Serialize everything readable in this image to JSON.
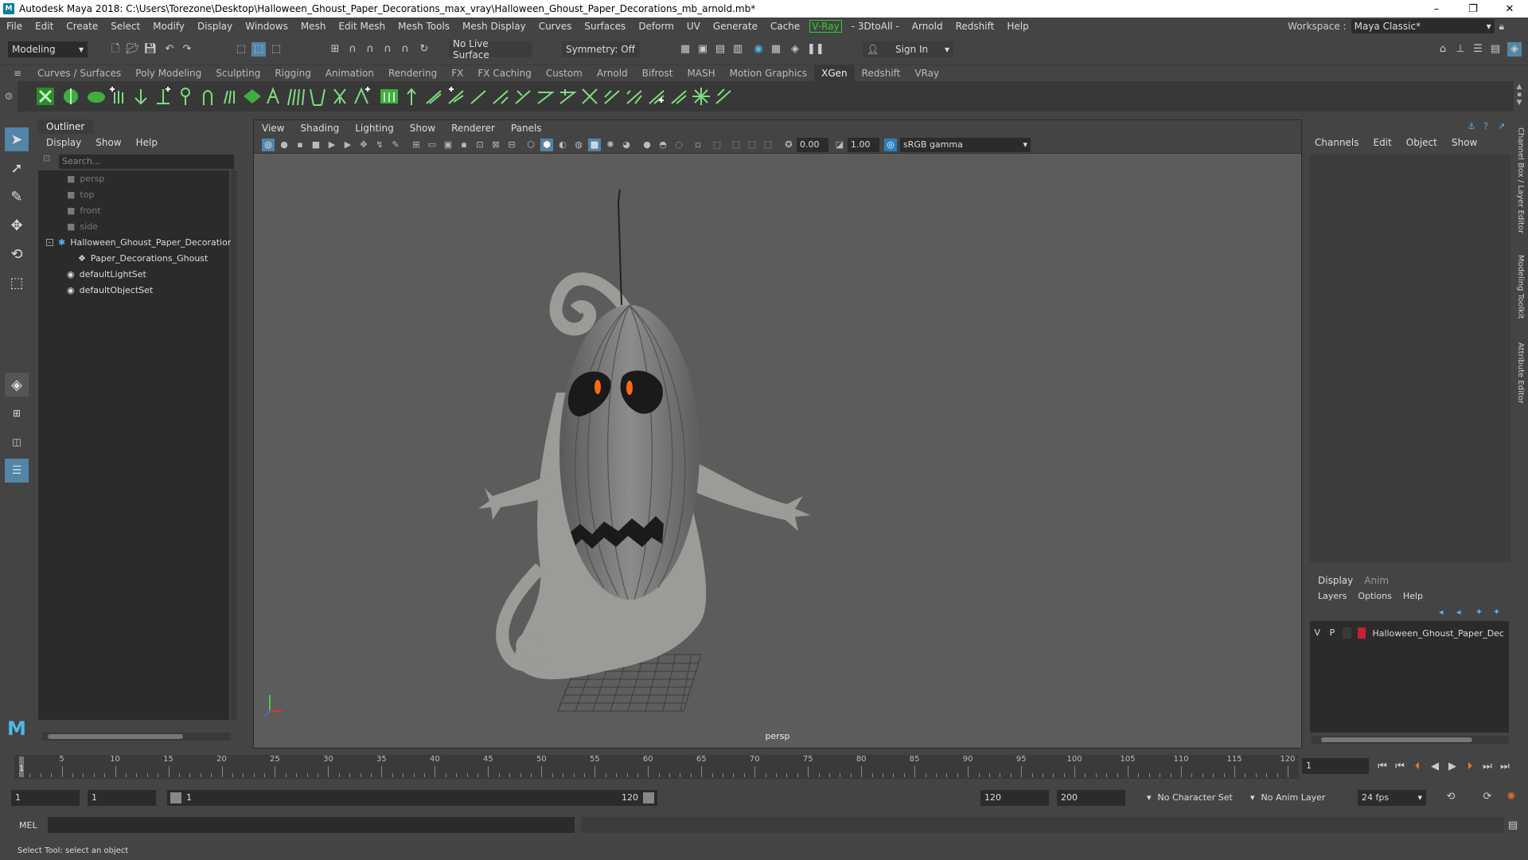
{
  "window": {
    "title": "Autodesk Maya 2018: C:\\Users\\Torezone\\Desktop\\Halloween_Ghoust_Paper_Decorations_max_vray\\Halloween_Ghoust_Paper_Decorations_mb_arnold.mb*",
    "icon_letter": "M",
    "minimize": "–",
    "restore": "❐",
    "close": "✕"
  },
  "menubar": {
    "items": [
      "File",
      "Edit",
      "Create",
      "Select",
      "Modify",
      "Display",
      "Windows",
      "Mesh",
      "Edit Mesh",
      "Mesh Tools",
      "Mesh Display",
      "Curves",
      "Surfaces",
      "Deform",
      "UV",
      "Generate",
      "Cache"
    ],
    "vray": "V-Ray",
    "items2": [
      "- 3DtoAll -",
      "Arnold",
      "Redshift",
      "Help"
    ],
    "workspace_label": "Workspace :",
    "workspace_value": "Maya Classic*"
  },
  "statusline": {
    "mode": "Modeling",
    "live_surface": "No Live Surface",
    "symmetry": "Symmetry: Off",
    "sign_in": "Sign In"
  },
  "shelf": {
    "tabs": [
      "Curves / Surfaces",
      "Poly Modeling",
      "Sculpting",
      "Rigging",
      "Animation",
      "Rendering",
      "FX",
      "FX Caching",
      "Custom",
      "Arnold",
      "Bifrost",
      "MASH",
      "Motion Graphics",
      "XGen",
      "Redshift",
      "VRay"
    ],
    "active_tab": "XGen"
  },
  "outliner": {
    "title": "Outliner",
    "menu": [
      "Display",
      "Show",
      "Help"
    ],
    "search_placeholder": "Search...",
    "items": [
      {
        "label": "persp",
        "kind": "camera"
      },
      {
        "label": "top",
        "kind": "camera"
      },
      {
        "label": "front",
        "kind": "camera"
      },
      {
        "label": "side",
        "kind": "camera"
      },
      {
        "label": "Halloween_Ghoust_Paper_Decoratior",
        "kind": "group"
      },
      {
        "label": "Paper_Decorations_Ghoust",
        "kind": "mesh"
      },
      {
        "label": "defaultLightSet",
        "kind": "set"
      },
      {
        "label": "defaultObjectSet",
        "kind": "set"
      }
    ]
  },
  "viewport": {
    "menu": [
      "View",
      "Shading",
      "Lighting",
      "Show",
      "Renderer",
      "Panels"
    ],
    "exposure": "0.00",
    "gamma": "1.00",
    "color_space": "sRGB gamma",
    "camera": "persp"
  },
  "channelbox": {
    "tabs": [
      "Channels",
      "Edit",
      "Object",
      "Show"
    ]
  },
  "layers": {
    "tabs": [
      "Display",
      "Anim"
    ],
    "menu": [
      "Layers",
      "Options",
      "Help"
    ],
    "row": {
      "v": "V",
      "p": "P",
      "name": "Halloween_Ghoust_Paper_Dec",
      "color": "#c81e3c"
    }
  },
  "sidetabs": [
    "Channel Box / Layer Editor",
    "Modeling Toolkit",
    "Attribute Editor"
  ],
  "timeline": {
    "labels": [
      "5",
      "10",
      "15",
      "20",
      "25",
      "30",
      "35",
      "40",
      "45",
      "50",
      "55",
      "60",
      "65",
      "70",
      "75",
      "80",
      "85",
      "90",
      "95",
      "100",
      "105",
      "110",
      "115",
      "120"
    ],
    "current_frame_marker": "1",
    "current_frame": "1"
  },
  "range": {
    "start": "1",
    "playback_start": "1",
    "slider_start": "1",
    "slider_end": "120",
    "playback_end": "120",
    "end": "200",
    "character_set": "No Character Set",
    "anim_layer": "No Anim Layer",
    "fps": "24 fps"
  },
  "cmdline": {
    "label": "MEL"
  },
  "helpline": {
    "text": "Select Tool: select an object"
  }
}
